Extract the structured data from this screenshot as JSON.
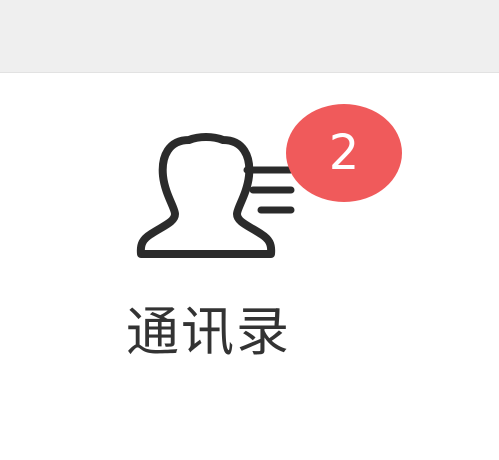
{
  "tab": {
    "label": "通讯录",
    "icon": "contacts-icon",
    "badge_count": "2"
  },
  "colors": {
    "top_bar": "#efefef",
    "background": "#ffffff",
    "icon_stroke": "#2b2b2b",
    "badge": "#f05a5b",
    "label": "#333333"
  }
}
